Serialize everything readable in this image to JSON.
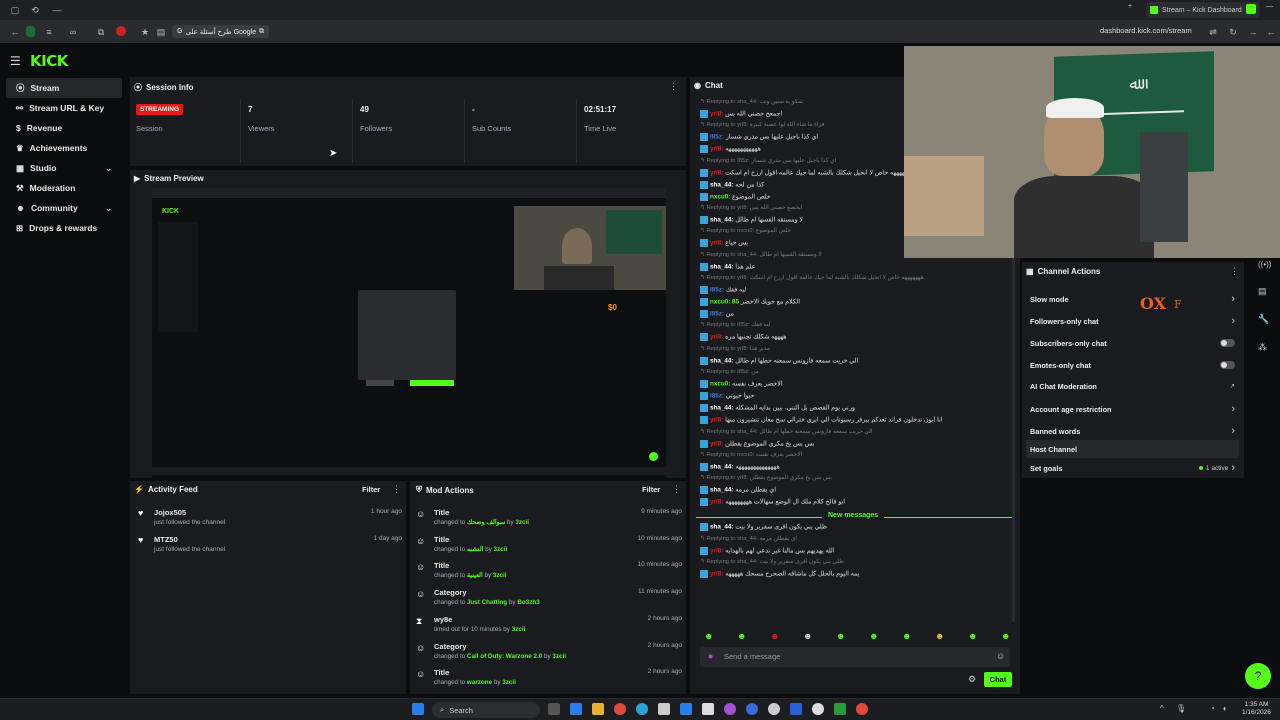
{
  "browser": {
    "tab_title": "Stream – Kick Dashboard",
    "bookmark": "طرح أسئلة على Google",
    "url": "dashboard.kick.com/stream"
  },
  "app": {
    "logo": "KICK"
  },
  "sidebar": {
    "items": [
      {
        "label": "Stream",
        "icon": "signal-icon"
      },
      {
        "label": "Stream URL & Key",
        "icon": "key-icon"
      },
      {
        "label": "Revenue",
        "icon": "dollar-icon"
      },
      {
        "label": "Achievements",
        "icon": "trophy-icon"
      },
      {
        "label": "Studio",
        "icon": "studio-icon"
      },
      {
        "label": "Moderation",
        "icon": "hammer-icon"
      },
      {
        "label": "Community",
        "icon": "people-icon"
      },
      {
        "label": "Drops & rewards",
        "icon": "gift-icon"
      }
    ]
  },
  "session": {
    "title": "Session Info",
    "badge": "STREAMING",
    "label_session": "Session",
    "viewers": "7",
    "label_viewers": "Viewers",
    "followers": "49",
    "label_followers": "Followers",
    "subs": "-",
    "label_subs": "Sub Counts",
    "time": "02:51:17",
    "label_time": "Time Live"
  },
  "preview": {
    "title": "Stream Preview"
  },
  "activity": {
    "title": "Activity Feed",
    "filter": "Filter",
    "items": [
      {
        "name": "Jojox505",
        "sub": "just followed the channel",
        "time": "1 hour ago"
      },
      {
        "name": "MTZ50",
        "sub": "just followed the channel",
        "time": "1 day ago"
      }
    ]
  },
  "mod": {
    "title": "Mod Actions",
    "filter": "Filter",
    "items": [
      {
        "name": "Title",
        "pre": "changed to",
        "val": "سوالف وضحك",
        "by": "3zcii",
        "time": "9 minutes ago",
        "icon": "person-icon"
      },
      {
        "name": "Title",
        "pre": "changed to",
        "val": "النشبه",
        "by": "3zcii",
        "time": "10 minutes ago",
        "icon": "person-icon"
      },
      {
        "name": "Title",
        "pre": "changed to",
        "val": "العينية",
        "by": "3zcii",
        "time": "10 minutes ago",
        "icon": "person-icon"
      },
      {
        "name": "Category",
        "pre": "changed to",
        "val": "Just Chatting",
        "by": "Bo3zh3",
        "time": "11 minutes ago",
        "icon": "person-icon"
      },
      {
        "name": "wy8e",
        "pre": "timed out for 10 minutes by",
        "val": "",
        "by": "3zcii",
        "time": "2 hours ago",
        "icon": "hourglass-icon"
      },
      {
        "name": "Category",
        "pre": "changed to",
        "val": "Call of Duty: Warzone 2.0",
        "by": "3zcii",
        "time": "2 hours ago",
        "icon": "person-icon"
      },
      {
        "name": "Title",
        "pre": "changed to",
        "val": "warzone",
        "by": "3zcii",
        "time": "2 hours ago",
        "icon": "person-icon"
      }
    ]
  },
  "chat": {
    "title": "Chat",
    "new_messages": "New messages",
    "placeholder": "Send a message",
    "send": "Chat",
    "lines": [
      {
        "t": "reply",
        "text": "Replying to sha_44: شكو به سبين ونت"
      },
      {
        "t": "msg",
        "user": "yrl8:",
        "color": "#e91916",
        "text": "اجمعح حصني الله يس"
      },
      {
        "t": "reply",
        "text": "Replying to yrl8: فزاء ما شاء الله لوا عصبة كبيرة"
      },
      {
        "t": "msg",
        "user": "I85z:",
        "color": "#3a7bd5",
        "text": "اي كذا باجيل عليها بس مدري شسار"
      },
      {
        "t": "msg",
        "user": "yrl8:",
        "color": "#e91916",
        "text": "هههههههههههه"
      },
      {
        "t": "reply",
        "text": "Replying to I85z: اي كذا باجيل عليها بس مدري شسار"
      },
      {
        "t": "msg",
        "user": "yrl8:",
        "color": "#e91916",
        "text": "هههههههه خاص لا انحيل شكلك بالشبه لما جيك عالمه اقول ارزح ام اسكت"
      },
      {
        "t": "msg",
        "user": "sha_44:",
        "color": "#ffffff",
        "text": "كذا من لحه"
      },
      {
        "t": "msg",
        "user": "nxcu0:",
        "color": "#53fc18",
        "text": "خلص الموضوع"
      },
      {
        "t": "reply",
        "text": "Replying to yrl8: ابخصع حصني الله يس"
      },
      {
        "t": "msg",
        "user": "sha_44:",
        "color": "#ffffff",
        "text": "لا ومستقه القسها ام طالل"
      },
      {
        "t": "reply",
        "text": "Replying to nxcu0: خلص الموضوع"
      },
      {
        "t": "msg",
        "user": "yrl8:",
        "color": "#e91916",
        "text": "بس جياع"
      },
      {
        "t": "reply",
        "text": "Replying to sha_44: لا ومستقه القسها ام طالل"
      },
      {
        "t": "msg",
        "user": "sha_44:",
        "color": "#ffffff",
        "text": "علم هذا"
      },
      {
        "t": "reply",
        "text": "Replying to yrl8: هههههههه خاص لا انحيل شكلك بالشبه لما جيك عالمه اقول ارزح ام اسكت"
      },
      {
        "t": "msg",
        "user": "I85z:",
        "color": "#3a7bd5",
        "text": "لبه فقك"
      },
      {
        "t": "msg",
        "user": "nxcu0: 85",
        "color": "#53fc18",
        "text": "الكلام مع خويك الاخضر"
      },
      {
        "t": "msg",
        "user": "I85z:",
        "color": "#3a7bd5",
        "text": "من"
      },
      {
        "t": "reply",
        "text": "Replying to I85z: لبه فقك"
      },
      {
        "t": "msg",
        "user": "yrl8:",
        "color": "#e91916",
        "text": "ههههه شكلك تجنبها مره"
      },
      {
        "t": "reply",
        "text": "Replying to yrl8: مدير هذا"
      },
      {
        "t": "msg",
        "user": "sha_44:",
        "color": "#ffffff",
        "text": "الي خريت سمعه فازونس سمعنه حطها ام طالل"
      },
      {
        "t": "reply",
        "text": "Replying to I85z: من"
      },
      {
        "t": "msg",
        "user": "nxcu0:",
        "color": "#53fc18",
        "text": "الاخضر يعرف نفسه"
      },
      {
        "t": "msg",
        "user": "I85z:",
        "color": "#3a7bd5",
        "text": "حيوا حيوتي"
      },
      {
        "t": "msg",
        "user": "sha_44:",
        "color": "#ffffff",
        "text": "ورني يوم القصص بل التني، بيين بدايه المشكله"
      },
      {
        "t": "msg",
        "user": "yrl8:",
        "color": "#e91916",
        "text": "انا ابون تدخلون فراند تعدكم بيرفر رسبونات الي ابري خترالي سح معان تنشيرون منها"
      },
      {
        "t": "reply",
        "text": "Replying to sha_44: الي خريت سمعه فازونس سمعنه حطها ام طالل"
      },
      {
        "t": "msg",
        "user": "yrl8:",
        "color": "#e91916",
        "text": "بس بس يخ مكري الموضوع يقطلن"
      },
      {
        "t": "reply",
        "text": "Replying to nxcu0: الاخضر يعرف نفسه"
      },
      {
        "t": "msg",
        "user": "sha_44:",
        "color": "#ffffff",
        "text": "ههههههههههههههه"
      },
      {
        "t": "reply",
        "text": "Replying to yrl8: بس بس يخ مكري الموضوع يقطلن"
      },
      {
        "t": "msg",
        "user": "sha_44:",
        "color": "#ffffff",
        "text": "اي يقطلن مرمه"
      },
      {
        "t": "msg",
        "user": "yrl8:",
        "color": "#e91916",
        "text": "ابو فالح كلام ملك ال الوضع سهالات ههههههههه"
      },
      {
        "t": "newdiv"
      },
      {
        "t": "msg",
        "user": "sha_44:",
        "color": "#ffffff",
        "text": "ظلي يبي يكون اقرى سفرير ولا بيت"
      },
      {
        "t": "reply",
        "text": "Replying to sha_44: اي يقطلن مرمه"
      },
      {
        "t": "msg",
        "user": "yrl8:",
        "color": "#e91916",
        "text": "الله يهديهم بس مالنا غير ندعي لهم بالهدايه"
      },
      {
        "t": "reply",
        "text": "Replying to sha_44: ظلي يبي يكون اقرى سفرير ولا بيت"
      },
      {
        "t": "msg",
        "user": "yrl8:",
        "color": "#e91916",
        "text": "يمه اليوم بالحلل كل ماشاقه الصحرح مسحك هههههه"
      }
    ]
  },
  "channel_actions": {
    "title": "Channel Actions",
    "rows": [
      {
        "label": "Slow mode",
        "kind": "arrow"
      },
      {
        "label": "Followers-only chat",
        "kind": "arrow"
      },
      {
        "label": "Subscribers-only chat",
        "kind": "toggle"
      },
      {
        "label": "Emotes-only chat",
        "kind": "toggle"
      },
      {
        "label": "AI Chat Moderation",
        "kind": "external"
      },
      {
        "label": "Account age restriction",
        "kind": "arrow"
      },
      {
        "label": "Banned words",
        "kind": "arrow"
      },
      {
        "label": "Host Channel",
        "kind": "none"
      },
      {
        "label": "Set goals",
        "kind": "goals",
        "extra": "1 active"
      }
    ]
  },
  "overlay": {
    "text": "OX",
    "small": "F"
  },
  "preview_overlay": {
    "money": "$0"
  },
  "taskbar": {
    "search": "Search",
    "time": "1:35 AM",
    "date": "1/16/2026"
  },
  "colors": {
    "accent": "#53fc18",
    "live": "#e91916"
  }
}
